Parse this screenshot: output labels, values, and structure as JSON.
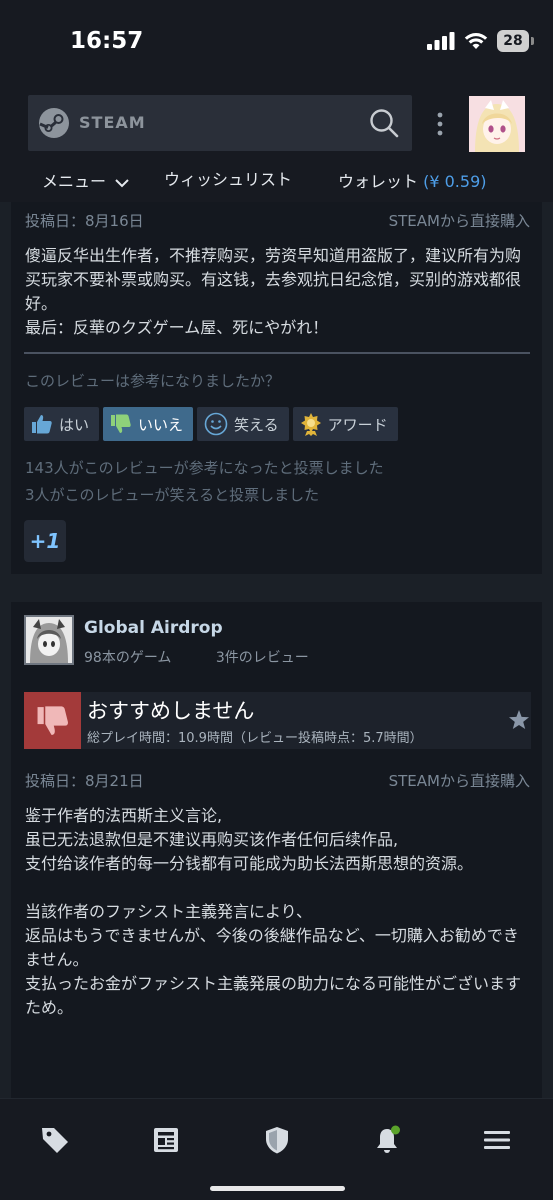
{
  "status_bar": {
    "time": "16:57",
    "battery": "28"
  },
  "header": {
    "brand": "STEAM",
    "nav": {
      "menu": "メニュー",
      "wishlist": "ウィッシュリスト",
      "wallet_label": "ウォレット",
      "wallet_amount": "(¥ 0.59)"
    }
  },
  "review1": {
    "posted": "投稿日：8月16日",
    "source": "STEAMから直接購入",
    "text": "傻逼反华出生作者，不推荐购买，劳资早知道用盗版了，建议所有为购买玩家不要补票或购买。有这钱，去参观抗日纪念馆，买别的游戏都很好。\n最后：反華のクズゲーム屋、死にやがれ！",
    "helpful_question": "このレビューは参考になりましたか？",
    "buttons": {
      "yes": "はい",
      "no": "いいえ",
      "funny": "笑える",
      "award": "アワード"
    },
    "helpful_count": "143人がこのレビューが参考になったと投票しました",
    "funny_count": "3人がこのレビューが笑えると投票しました",
    "plus_one": "+1"
  },
  "review2": {
    "author": "Global Airdrop",
    "games": "98本のゲーム",
    "reviews": "3件のレビュー",
    "recommendation": "おすすめしません",
    "playtime": "総プレイ時間：10.9時間（レビュー投稿時点：5.7時間）",
    "posted": "投稿日：8月21日",
    "source": "STEAMから直接購入",
    "text": "鉴于作者的法西斯主义言论,\n虽已无法退款但是不建议再购买该作者任何后续作品,\n支付给该作者的每一分钱都有可能成为助长法西斯思想的资源。\n\n当該作者のファシスト主義発言により、\n返品はもうできませんが、今後の後継作品など、一切購入お勧めできません。\n支払ったお金がファシスト主義発展の助力になる可能性がございますため。"
  },
  "colors": {
    "accent": "#4e9ee8",
    "negative": "#a33a3a",
    "background": "#171a21"
  }
}
